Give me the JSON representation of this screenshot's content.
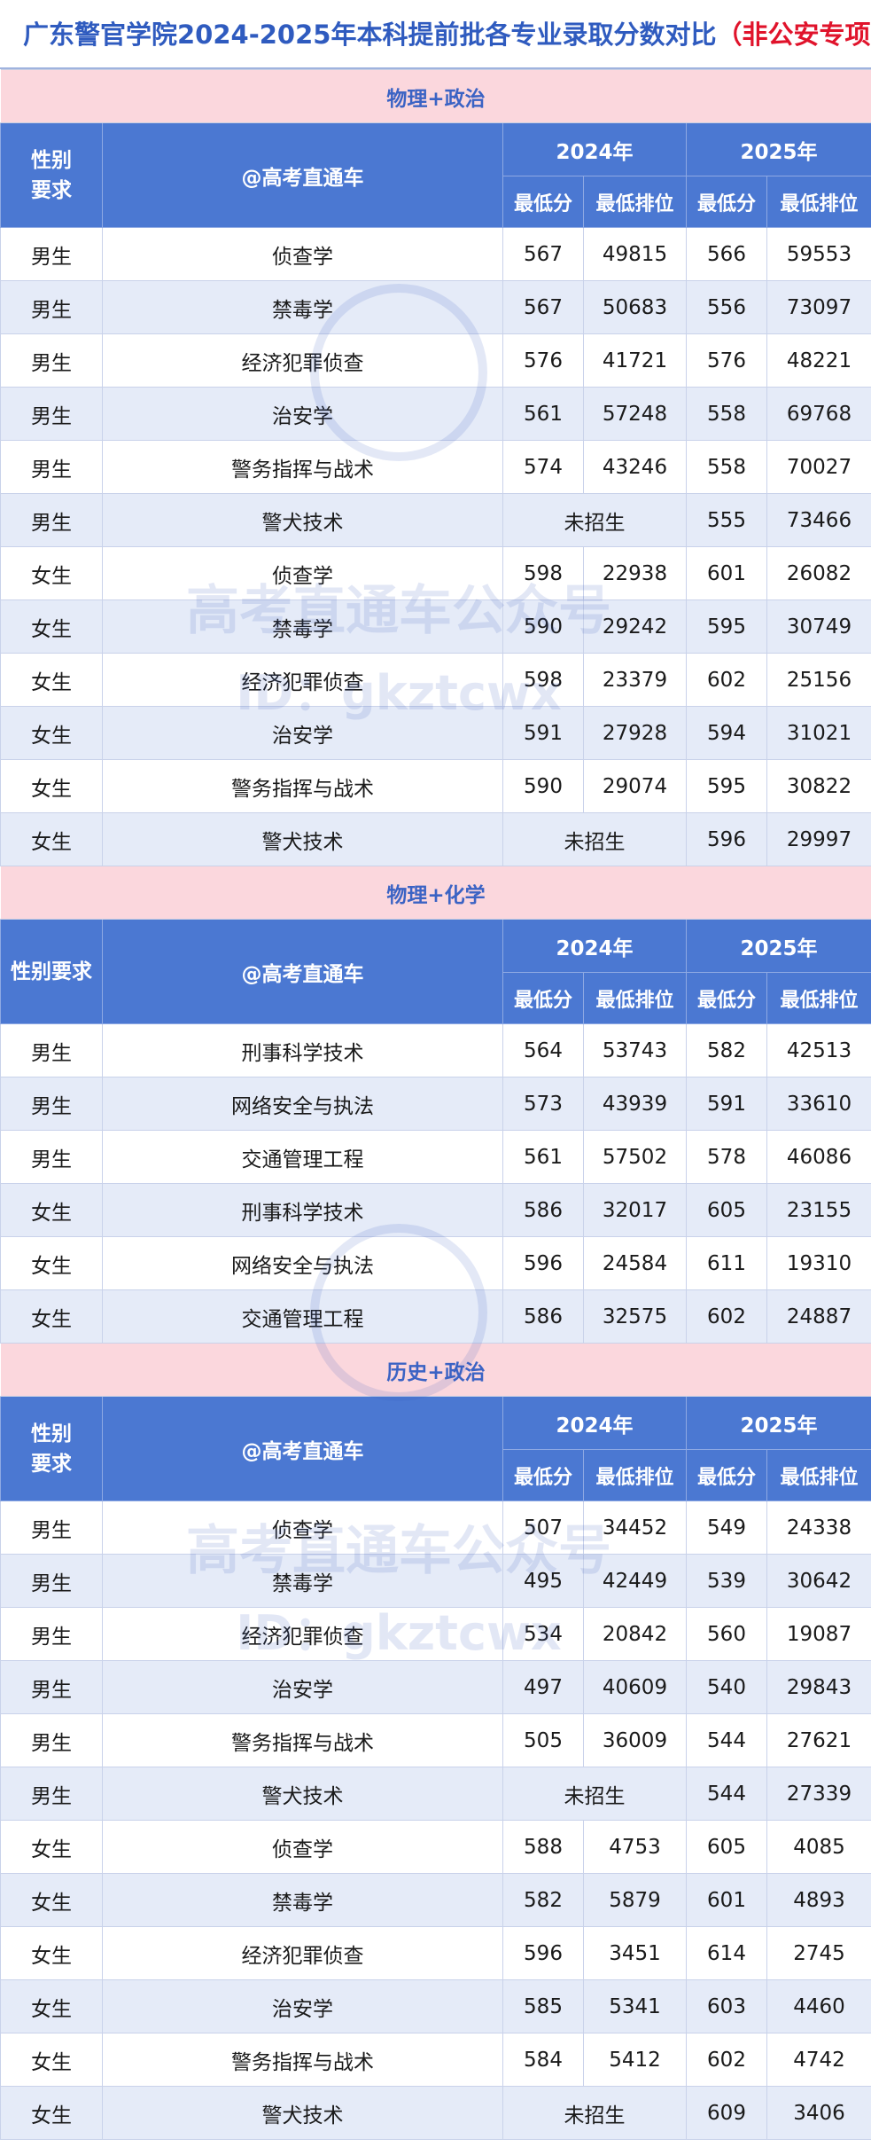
{
  "title_main": "广东警官学院2024-2025年本科提前批各专业录取分数对比",
  "title_em": "（非公安专项）",
  "header": {
    "gender": "性别要求",
    "major": "@高考直通车",
    "y2024": "2024年",
    "y2025": "2025年",
    "min_score": "最低分",
    "min_rank": "最低排位"
  },
  "watermark": {
    "text": "高考直通车公众号",
    "id": "ID：gkztcwx"
  },
  "sections": [
    {
      "name": "物理+政治",
      "rows": [
        [
          "男生",
          "侦查学",
          "567",
          "49815",
          "566",
          "59553"
        ],
        [
          "男生",
          "禁毒学",
          "567",
          "50683",
          "556",
          "73097"
        ],
        [
          "男生",
          "经济犯罪侦查",
          "576",
          "41721",
          "576",
          "48221"
        ],
        [
          "男生",
          "治安学",
          "561",
          "57248",
          "558",
          "69768"
        ],
        [
          "男生",
          "警务指挥与战术",
          "574",
          "43246",
          "558",
          "70027"
        ],
        [
          "男生",
          "警犬技术",
          "未招生",
          "",
          "555",
          "73466"
        ],
        [
          "女生",
          "侦查学",
          "598",
          "22938",
          "601",
          "26082"
        ],
        [
          "女生",
          "禁毒学",
          "590",
          "29242",
          "595",
          "30749"
        ],
        [
          "女生",
          "经济犯罪侦查",
          "598",
          "23379",
          "602",
          "25156"
        ],
        [
          "女生",
          "治安学",
          "591",
          "27928",
          "594",
          "31021"
        ],
        [
          "女生",
          "警务指挥与战术",
          "590",
          "29074",
          "595",
          "30822"
        ],
        [
          "女生",
          "警犬技术",
          "未招生",
          "",
          "596",
          "29997"
        ]
      ]
    },
    {
      "name": "物理+化学",
      "rows": [
        [
          "男生",
          "刑事科学技术",
          "564",
          "53743",
          "582",
          "42513"
        ],
        [
          "男生",
          "网络安全与执法",
          "573",
          "43939",
          "591",
          "33610"
        ],
        [
          "男生",
          "交通管理工程",
          "561",
          "57502",
          "578",
          "46086"
        ],
        [
          "女生",
          "刑事科学技术",
          "586",
          "32017",
          "605",
          "23155"
        ],
        [
          "女生",
          "网络安全与执法",
          "596",
          "24584",
          "611",
          "19310"
        ],
        [
          "女生",
          "交通管理工程",
          "586",
          "32575",
          "602",
          "24887"
        ]
      ]
    },
    {
      "name": "历史+政治",
      "rows": [
        [
          "男生",
          "侦查学",
          "507",
          "34452",
          "549",
          "24338"
        ],
        [
          "男生",
          "禁毒学",
          "495",
          "42449",
          "539",
          "30642"
        ],
        [
          "男生",
          "经济犯罪侦查",
          "534",
          "20842",
          "560",
          "19087"
        ],
        [
          "男生",
          "治安学",
          "497",
          "40609",
          "540",
          "29843"
        ],
        [
          "男生",
          "警务指挥与战术",
          "505",
          "36009",
          "544",
          "27621"
        ],
        [
          "男生",
          "警犬技术",
          "未招生",
          "",
          "544",
          "27339"
        ],
        [
          "女生",
          "侦查学",
          "588",
          "4753",
          "605",
          "4085"
        ],
        [
          "女生",
          "禁毒学",
          "582",
          "5879",
          "601",
          "4893"
        ],
        [
          "女生",
          "经济犯罪侦查",
          "596",
          "3451",
          "614",
          "2745"
        ],
        [
          "女生",
          "治安学",
          "585",
          "5341",
          "603",
          "4460"
        ],
        [
          "女生",
          "警务指挥与战术",
          "584",
          "5412",
          "602",
          "4742"
        ],
        [
          "女生",
          "警犬技术",
          "未招生",
          "",
          "609",
          "3406"
        ]
      ]
    }
  ]
}
